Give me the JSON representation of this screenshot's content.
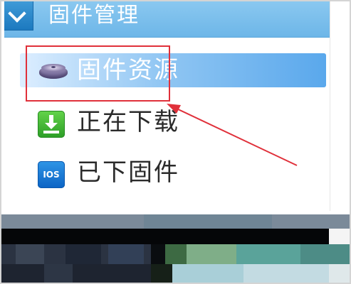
{
  "section": {
    "title": "固件管理",
    "header_color": "#7dbfea"
  },
  "menu": {
    "items": [
      {
        "label": "固件资源",
        "icon": "disk-icon",
        "selected": true
      },
      {
        "label": "正在下载",
        "icon": "download-icon",
        "selected": false
      },
      {
        "label": "已下固件",
        "icon": "ios-icon",
        "icon_text": "IOS",
        "selected": false
      }
    ]
  },
  "annotation": {
    "color": "#e0303a"
  }
}
